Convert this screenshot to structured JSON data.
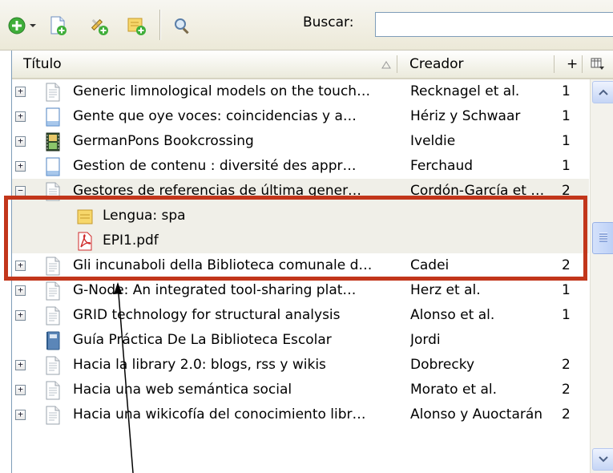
{
  "toolbar": {
    "search_label": "Buscar:",
    "search_value": ""
  },
  "columns": {
    "title": "Título",
    "creator": "Creador",
    "extra": "+"
  },
  "rows": [
    {
      "title": "Generic limnological models on the touch…",
      "creator": "Recknagel et al.",
      "count": "1",
      "icon": "document-icon",
      "expanded": false
    },
    {
      "title": "Gente que oye voces: coincidencias y a…",
      "creator": "Hériz y Schwaar",
      "count": "1",
      "icon": "blank-page-icon",
      "expanded": false
    },
    {
      "title": "GermanPons Bookcrossing",
      "creator": "Iveldie",
      "count": "1",
      "icon": "film-icon",
      "expanded": false
    },
    {
      "title": "Gestion de contenu : diversité des appr…",
      "creator": "Ferchaud",
      "count": "1",
      "icon": "blank-page-icon",
      "expanded": false
    },
    {
      "title": "Gestores de referencias de última gener…",
      "creator": "Cordón-García et …",
      "count": "2",
      "icon": "document-icon",
      "expanded": true
    },
    {
      "title": "Lengua: spa",
      "creator": "",
      "count": "",
      "icon": "note-icon",
      "child": true
    },
    {
      "title": "EPI1.pdf",
      "creator": "",
      "count": "",
      "icon": "pdf-icon",
      "child": true
    },
    {
      "title": "Gli incunaboli della Biblioteca comunale d…",
      "creator": "Cadei",
      "count": "2",
      "icon": "document-icon",
      "expanded": false
    },
    {
      "title": "G-Node: An integrated tool-sharing plat…",
      "creator": "Herz et al.",
      "count": "1",
      "icon": "document-icon",
      "expanded": false
    },
    {
      "title": "GRID technology for structural analysis",
      "creator": "Alonso et al.",
      "count": "1",
      "icon": "document-icon",
      "expanded": false
    },
    {
      "title": "Guía Práctica De La Biblioteca Escolar",
      "creator": "Jordi",
      "count": "",
      "icon": "book-icon",
      "noTwisty": true
    },
    {
      "title": "Hacia la library 2.0: blogs, rss y wikis",
      "creator": "Dobrecky",
      "count": "2",
      "icon": "document-icon",
      "expanded": false
    },
    {
      "title": "Hacia una web semántica social",
      "creator": "Morato et al.",
      "count": "2",
      "icon": "document-icon",
      "expanded": false
    },
    {
      "title": "Hacia una wikicofía del conocimiento libr…",
      "creator": "Alonso y Auoctarán",
      "count": "2",
      "icon": "document-icon",
      "expanded": false
    }
  ],
  "colors": {
    "callout": "#c2361b",
    "header_bg": "#ebeadb",
    "scrollbar_accent": "#c5d5f5"
  }
}
